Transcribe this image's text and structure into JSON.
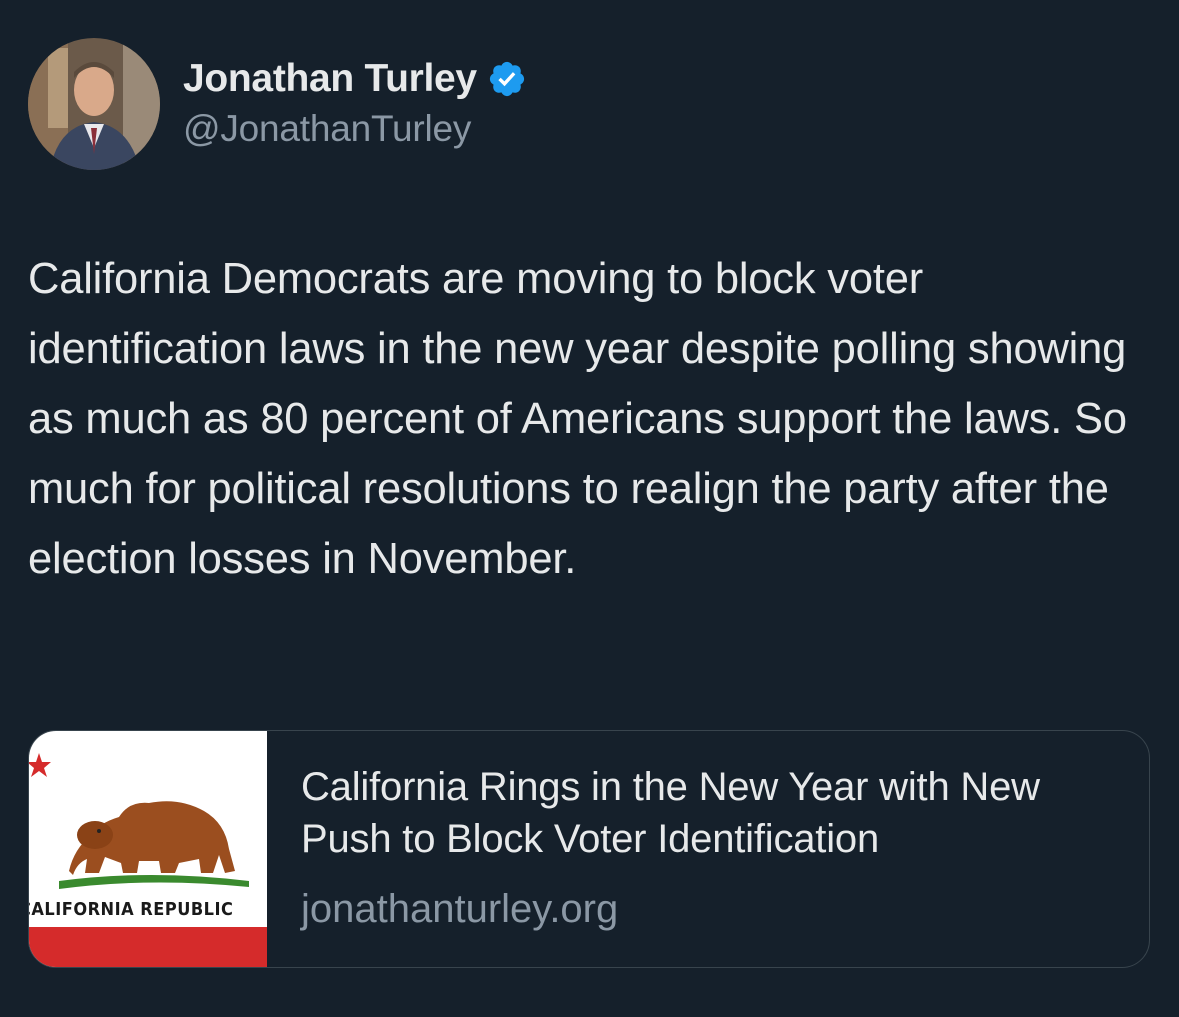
{
  "author": {
    "display_name": "Jonathan Turley",
    "handle": "@JonathanTurley",
    "verified": true,
    "verified_icon": "verified-badge-icon",
    "verified_color": "#1d9bf0"
  },
  "tweet": {
    "text": "California Democrats are moving to block voter identification laws in the new year despite polling showing as much as 80 percent of Americans support the laws. So much for political resolutions to realign the party after the election losses in November."
  },
  "link_card": {
    "title": "California Rings in the New Year with New Push to Block Voter Identification",
    "domain": "jonathanturley.org",
    "image_caption": "CALIFORNIA REPUBLIC"
  },
  "colors": {
    "background": "#15202b",
    "text_primary": "#e7e9ea",
    "text_secondary": "#8b98a5",
    "card_border": "#38444d"
  }
}
